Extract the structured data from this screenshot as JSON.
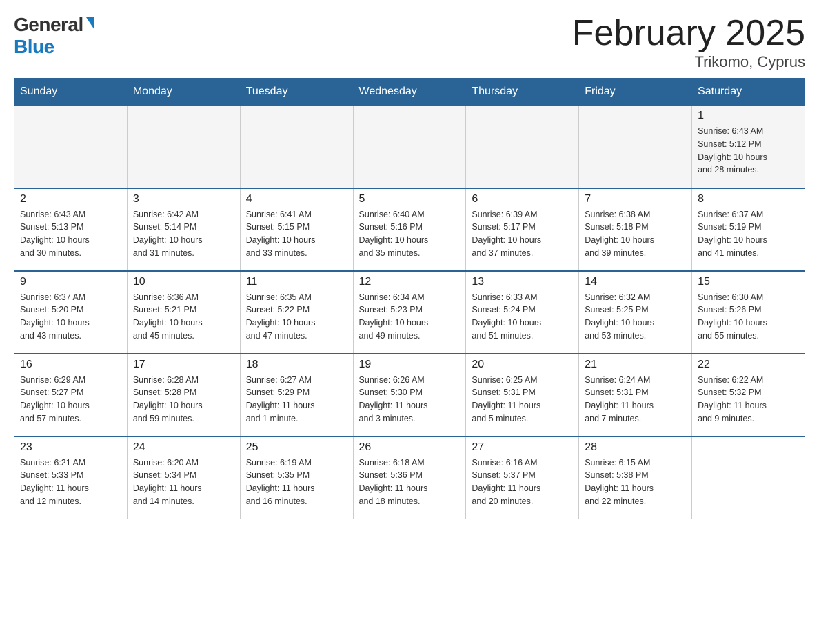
{
  "header": {
    "logo_general": "General",
    "logo_blue": "Blue",
    "title": "February 2025",
    "subtitle": "Trikomo, Cyprus"
  },
  "days_of_week": [
    "Sunday",
    "Monday",
    "Tuesday",
    "Wednesday",
    "Thursday",
    "Friday",
    "Saturday"
  ],
  "weeks": [
    {
      "days": [
        {
          "number": "",
          "info": ""
        },
        {
          "number": "",
          "info": ""
        },
        {
          "number": "",
          "info": ""
        },
        {
          "number": "",
          "info": ""
        },
        {
          "number": "",
          "info": ""
        },
        {
          "number": "",
          "info": ""
        },
        {
          "number": "1",
          "info": "Sunrise: 6:43 AM\nSunset: 5:12 PM\nDaylight: 10 hours\nand 28 minutes."
        }
      ]
    },
    {
      "days": [
        {
          "number": "2",
          "info": "Sunrise: 6:43 AM\nSunset: 5:13 PM\nDaylight: 10 hours\nand 30 minutes."
        },
        {
          "number": "3",
          "info": "Sunrise: 6:42 AM\nSunset: 5:14 PM\nDaylight: 10 hours\nand 31 minutes."
        },
        {
          "number": "4",
          "info": "Sunrise: 6:41 AM\nSunset: 5:15 PM\nDaylight: 10 hours\nand 33 minutes."
        },
        {
          "number": "5",
          "info": "Sunrise: 6:40 AM\nSunset: 5:16 PM\nDaylight: 10 hours\nand 35 minutes."
        },
        {
          "number": "6",
          "info": "Sunrise: 6:39 AM\nSunset: 5:17 PM\nDaylight: 10 hours\nand 37 minutes."
        },
        {
          "number": "7",
          "info": "Sunrise: 6:38 AM\nSunset: 5:18 PM\nDaylight: 10 hours\nand 39 minutes."
        },
        {
          "number": "8",
          "info": "Sunrise: 6:37 AM\nSunset: 5:19 PM\nDaylight: 10 hours\nand 41 minutes."
        }
      ]
    },
    {
      "days": [
        {
          "number": "9",
          "info": "Sunrise: 6:37 AM\nSunset: 5:20 PM\nDaylight: 10 hours\nand 43 minutes."
        },
        {
          "number": "10",
          "info": "Sunrise: 6:36 AM\nSunset: 5:21 PM\nDaylight: 10 hours\nand 45 minutes."
        },
        {
          "number": "11",
          "info": "Sunrise: 6:35 AM\nSunset: 5:22 PM\nDaylight: 10 hours\nand 47 minutes."
        },
        {
          "number": "12",
          "info": "Sunrise: 6:34 AM\nSunset: 5:23 PM\nDaylight: 10 hours\nand 49 minutes."
        },
        {
          "number": "13",
          "info": "Sunrise: 6:33 AM\nSunset: 5:24 PM\nDaylight: 10 hours\nand 51 minutes."
        },
        {
          "number": "14",
          "info": "Sunrise: 6:32 AM\nSunset: 5:25 PM\nDaylight: 10 hours\nand 53 minutes."
        },
        {
          "number": "15",
          "info": "Sunrise: 6:30 AM\nSunset: 5:26 PM\nDaylight: 10 hours\nand 55 minutes."
        }
      ]
    },
    {
      "days": [
        {
          "number": "16",
          "info": "Sunrise: 6:29 AM\nSunset: 5:27 PM\nDaylight: 10 hours\nand 57 minutes."
        },
        {
          "number": "17",
          "info": "Sunrise: 6:28 AM\nSunset: 5:28 PM\nDaylight: 10 hours\nand 59 minutes."
        },
        {
          "number": "18",
          "info": "Sunrise: 6:27 AM\nSunset: 5:29 PM\nDaylight: 11 hours\nand 1 minute."
        },
        {
          "number": "19",
          "info": "Sunrise: 6:26 AM\nSunset: 5:30 PM\nDaylight: 11 hours\nand 3 minutes."
        },
        {
          "number": "20",
          "info": "Sunrise: 6:25 AM\nSunset: 5:31 PM\nDaylight: 11 hours\nand 5 minutes."
        },
        {
          "number": "21",
          "info": "Sunrise: 6:24 AM\nSunset: 5:31 PM\nDaylight: 11 hours\nand 7 minutes."
        },
        {
          "number": "22",
          "info": "Sunrise: 6:22 AM\nSunset: 5:32 PM\nDaylight: 11 hours\nand 9 minutes."
        }
      ]
    },
    {
      "days": [
        {
          "number": "23",
          "info": "Sunrise: 6:21 AM\nSunset: 5:33 PM\nDaylight: 11 hours\nand 12 minutes."
        },
        {
          "number": "24",
          "info": "Sunrise: 6:20 AM\nSunset: 5:34 PM\nDaylight: 11 hours\nand 14 minutes."
        },
        {
          "number": "25",
          "info": "Sunrise: 6:19 AM\nSunset: 5:35 PM\nDaylight: 11 hours\nand 16 minutes."
        },
        {
          "number": "26",
          "info": "Sunrise: 6:18 AM\nSunset: 5:36 PM\nDaylight: 11 hours\nand 18 minutes."
        },
        {
          "number": "27",
          "info": "Sunrise: 6:16 AM\nSunset: 5:37 PM\nDaylight: 11 hours\nand 20 minutes."
        },
        {
          "number": "28",
          "info": "Sunrise: 6:15 AM\nSunset: 5:38 PM\nDaylight: 11 hours\nand 22 minutes."
        },
        {
          "number": "",
          "info": ""
        }
      ]
    }
  ]
}
